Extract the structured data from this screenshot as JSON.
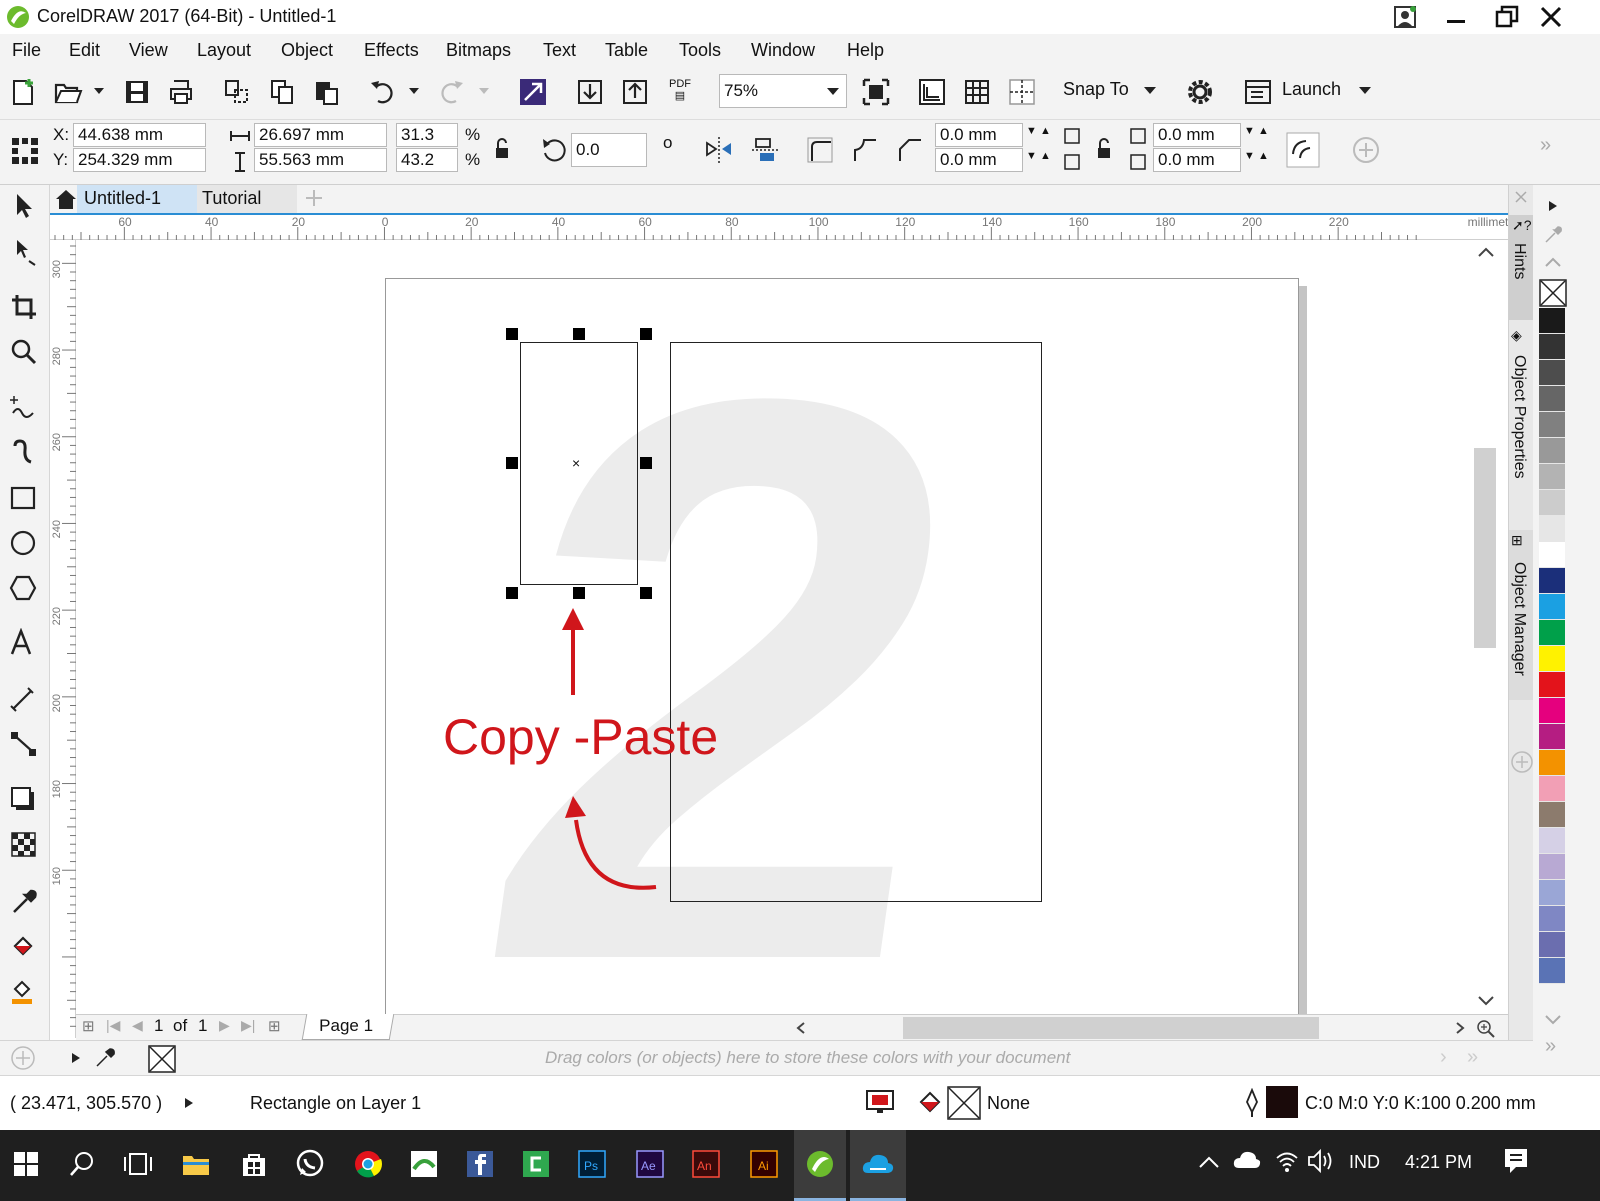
{
  "window": {
    "title": "CorelDRAW 2017 (64-Bit) - Untitled-1"
  },
  "menu": [
    "File",
    "Edit",
    "View",
    "Layout",
    "Object",
    "Effects",
    "Bitmaps",
    "Text",
    "Table",
    "Tools",
    "Window",
    "Help"
  ],
  "toolbar": {
    "zoom": "75%",
    "snap_to": "Snap To",
    "launch": "Launch",
    "pdf_label": "PDF"
  },
  "properties": {
    "x_label": "X:",
    "x": "44.638 mm",
    "y_label": "Y:",
    "y": "254.329 mm",
    "width": "26.697 mm",
    "height": "55.563 mm",
    "scale_w": "31.3",
    "scale_h": "43.2",
    "percent": "%",
    "rotation": "0.0",
    "degree": "o",
    "corner_1": "0.0 mm",
    "corner_2": "0.0 mm",
    "corner_3": "0.0 mm",
    "corner_4": "0.0 mm"
  },
  "tabs": [
    {
      "label": "Untitled-1",
      "active": true
    },
    {
      "label": "Tutorial",
      "active": false
    }
  ],
  "ruler": {
    "h_ticks": [
      "60",
      "40",
      "20",
      "0",
      "20",
      "40",
      "60",
      "80",
      "100",
      "120",
      "140",
      "160",
      "180",
      "200",
      "220"
    ],
    "unit": "millimeters",
    "v_ticks": [
      "300",
      "280",
      "260",
      "240",
      "220",
      "200",
      "180",
      "160"
    ]
  },
  "canvas": {
    "annotation": "Copy -Paste",
    "watermark": "2",
    "accent": "#d0161b"
  },
  "dockers": [
    "Hints",
    "Object Properties",
    "Object Manager"
  ],
  "page_nav": {
    "current": "1",
    "of": "of",
    "total": "1",
    "page_tab": "Page 1"
  },
  "document_palette": {
    "hint": "Drag colors (or objects) here to store these colors with your document"
  },
  "status": {
    "coords": "( 23.471, 305.570 )",
    "object": "Rectangle on Layer 1",
    "fill": "None",
    "outline": "C:0 M:0 Y:0 K:100  0.200 mm"
  },
  "palette_colors": [
    "#1a1a1a",
    "#333333",
    "#4d4d4d",
    "#666666",
    "#808080",
    "#999999",
    "#b3b3b3",
    "#cccccc",
    "#e6e6e6",
    "#ffffff",
    "#1b2f7a",
    "#1ba0e2",
    "#00a04a",
    "#fff200",
    "#e3131b",
    "#e5007e",
    "#b51d82",
    "#f39200",
    "#f29fb5",
    "#8c7b6d",
    "#d5d0e6",
    "#b8a9d3",
    "#9aa6d6",
    "#7f87c4",
    "#6b6eaf",
    "#5a73b5"
  ],
  "taskbar": {
    "time": "4:21 PM",
    "lang": "IND"
  }
}
